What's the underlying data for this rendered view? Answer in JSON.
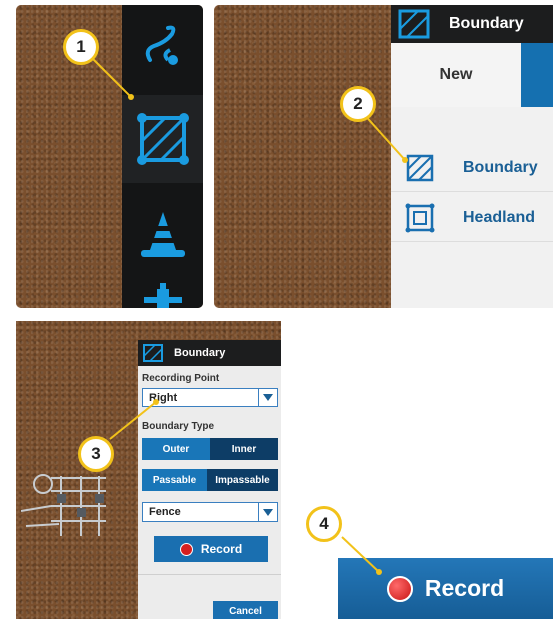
{
  "panel1": {
    "icons": [
      "path-icon",
      "boundary-icon",
      "cone-icon",
      "implement-icon"
    ]
  },
  "panel2": {
    "header_title": "Boundary",
    "tab_new": "New",
    "items": [
      {
        "label": "Boundary",
        "icon": "boundary-icon"
      },
      {
        "label": "Headland",
        "icon": "headland-icon"
      }
    ]
  },
  "panel3": {
    "header_title": "Boundary",
    "recording_point_label": "Recording Point",
    "recording_point_value": "Right",
    "boundary_type_label": "Boundary Type",
    "type_outer": "Outer",
    "type_inner": "Inner",
    "passable": "Passable",
    "impassable": "Impassable",
    "fence_value": "Fence",
    "record_label": "Record",
    "cancel_label": "Cancel"
  },
  "panel4": {
    "record_label": "Record"
  },
  "callouts": [
    "1",
    "2",
    "3",
    "4"
  ],
  "colors": {
    "accent_blue": "#1a9be0",
    "callout_yellow": "#f2c21a",
    "record_red": "#d61f1f",
    "button_blue": "#1976b8"
  }
}
